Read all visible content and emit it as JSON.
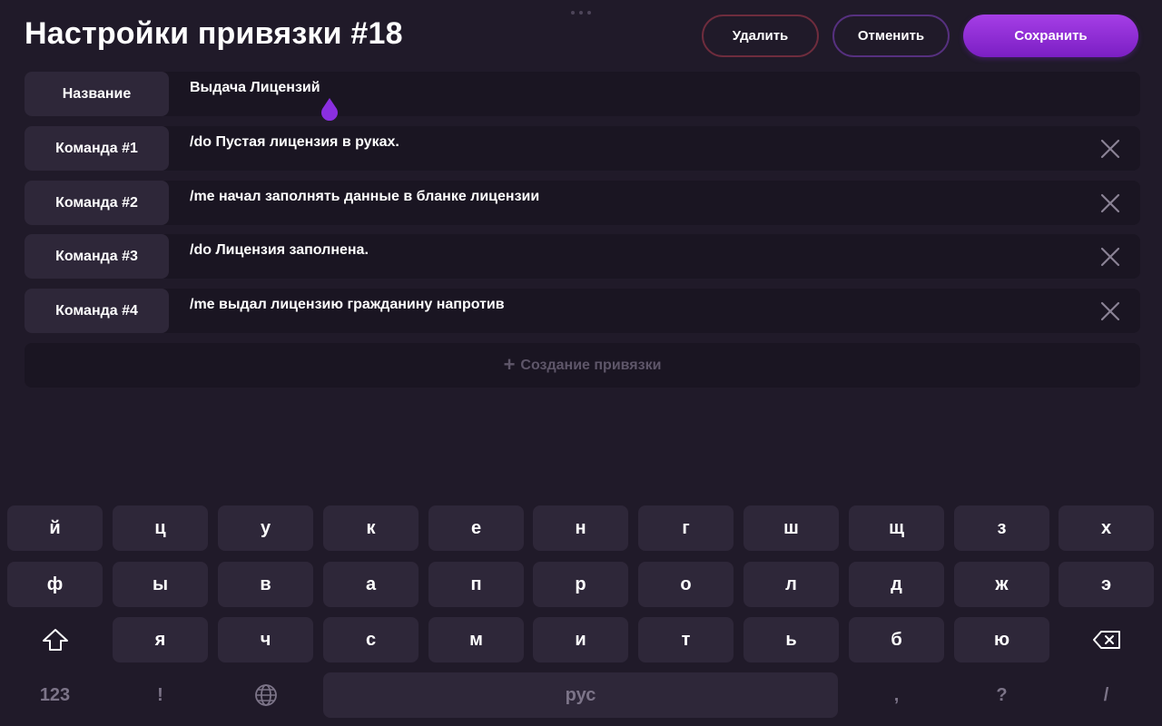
{
  "header": {
    "title": "Настройки привязки #18",
    "delete_label": "Удалить",
    "cancel_label": "Отменить",
    "save_label": "Сохранить"
  },
  "name_row": {
    "label": "Название",
    "value": "Выдача Лицензий"
  },
  "commands": [
    {
      "label": "Команда #1",
      "value": "/do Пустая лицензия в руках."
    },
    {
      "label": "Команда #2",
      "value": "/me начал заполнять данные в бланке лицензии"
    },
    {
      "label": "Команда #3",
      "value": "/do Лицензия заполнена."
    },
    {
      "label": "Команда #4",
      "value": "/me выдал лицензию гражданину напротив"
    }
  ],
  "add_binding": {
    "plus": "+",
    "label": "Создание привязки"
  },
  "keyboard": {
    "row1": [
      "й",
      "ц",
      "у",
      "к",
      "е",
      "н",
      "г",
      "ш",
      "щ",
      "з",
      "х"
    ],
    "row2": [
      "ф",
      "ы",
      "в",
      "а",
      "п",
      "р",
      "о",
      "л",
      "д",
      "ж",
      "э"
    ],
    "row3": [
      "я",
      "ч",
      "с",
      "м",
      "и",
      "т",
      "ь",
      "б",
      "ю"
    ],
    "row4": {
      "numbers": "123",
      "exclaim": "!",
      "space": "рус",
      "comma": ",",
      "question": "?",
      "slash": "/"
    }
  },
  "colors": {
    "background": "#201a29",
    "accent": "#9b33e0",
    "delete_border": "#6e2c3d",
    "cancel_border": "#56307f"
  },
  "icons": {
    "close": "close-icon",
    "shift": "shift-icon",
    "backspace": "backspace-icon",
    "globe": "globe-icon",
    "cursor": "text-cursor-handle-icon"
  }
}
